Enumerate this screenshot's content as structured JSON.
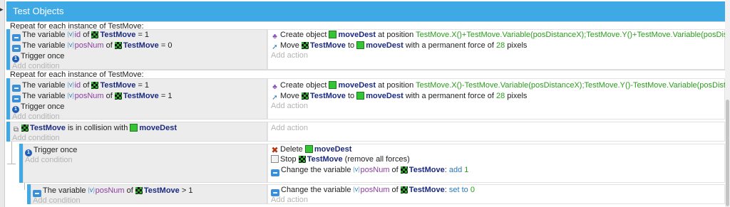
{
  "group": {
    "title": "Test Objects"
  },
  "icons": {
    "variable": "variable-icon",
    "object": "testmove-sprite-icon",
    "target": "movedest-sprite-icon",
    "trigger": "trigger-once-icon",
    "create": "create-object-icon",
    "move": "move-object-icon",
    "delete": "delete-icon",
    "stop": "stop-icon",
    "collision": "collision-icon"
  },
  "labels": {
    "add_condition": "Add condition",
    "add_action": "Add action"
  },
  "event1": {
    "repeat": "Repeat for each instance of TestMove:",
    "c1": {
      "pre": "The variable ",
      "var": "id",
      "mid": " of ",
      "obj": "TestMove",
      "tail": " = 1"
    },
    "c2": {
      "pre": "The variable ",
      "var": "posNum",
      "mid": " of ",
      "obj": "TestMove",
      "tail": " = 0"
    },
    "c3": "Trigger once",
    "a1": {
      "pre": "Create object ",
      "obj": "moveDest",
      "mid": " at position ",
      "expr": "TestMove.X()+TestMove.Variable(posDistanceX);TestMove.Y()+TestMove.Variable(posDistanceY)"
    },
    "a2": {
      "pre": "Move ",
      "obj": "TestMove",
      "mid": " to ",
      "target": "moveDest",
      "tail1": " with a permanent force of ",
      "num": "28",
      "tail2": " pixels"
    }
  },
  "event2": {
    "repeat": "Repeat for each instance of TestMove:",
    "c1": {
      "pre": "The variable ",
      "var": "id",
      "mid": " of ",
      "obj": "TestMove",
      "tail": " = 1"
    },
    "c2": {
      "pre": "The variable ",
      "var": "posNum",
      "mid": " of ",
      "obj": "TestMove",
      "tail": " = 1"
    },
    "c3": "Trigger once",
    "a1": {
      "pre": "Create object ",
      "obj": "moveDest",
      "mid": " at position ",
      "expr": "TestMove.X()-TestMove.Variable(posDistanceX);TestMove.Y()-TestMove.Variable(posDistanceY)"
    },
    "a2": {
      "pre": "Move ",
      "obj": "TestMove",
      "mid": " to ",
      "target": "moveDest",
      "tail1": " with a permanent force of ",
      "num": "28",
      "tail2": " pixels"
    }
  },
  "event3": {
    "c1": {
      "obj": "TestMove",
      "mid": " is in collision with ",
      "target": "moveDest"
    }
  },
  "event4": {
    "c1": "Trigger once",
    "a1": {
      "pre": "Delete ",
      "obj": "moveDest"
    },
    "a2": {
      "pre": "Stop ",
      "obj": "TestMove",
      "tail": " (remove all forces)"
    },
    "a3": {
      "pre": "Change the variable ",
      "var": "posNum",
      "mid": " of ",
      "obj": "TestMove",
      "colon": ": ",
      "op": "add",
      "num": "1"
    }
  },
  "event5": {
    "c1": {
      "pre": "The variable ",
      "var": "posNum",
      "mid": " of ",
      "obj": "TestMove",
      "tail": " > 1"
    },
    "a1": {
      "pre": "Change the variable ",
      "var": "posNum",
      "mid": " of ",
      "obj": "TestMove",
      "colon": ": ",
      "op": "set to",
      "num": "0"
    }
  }
}
